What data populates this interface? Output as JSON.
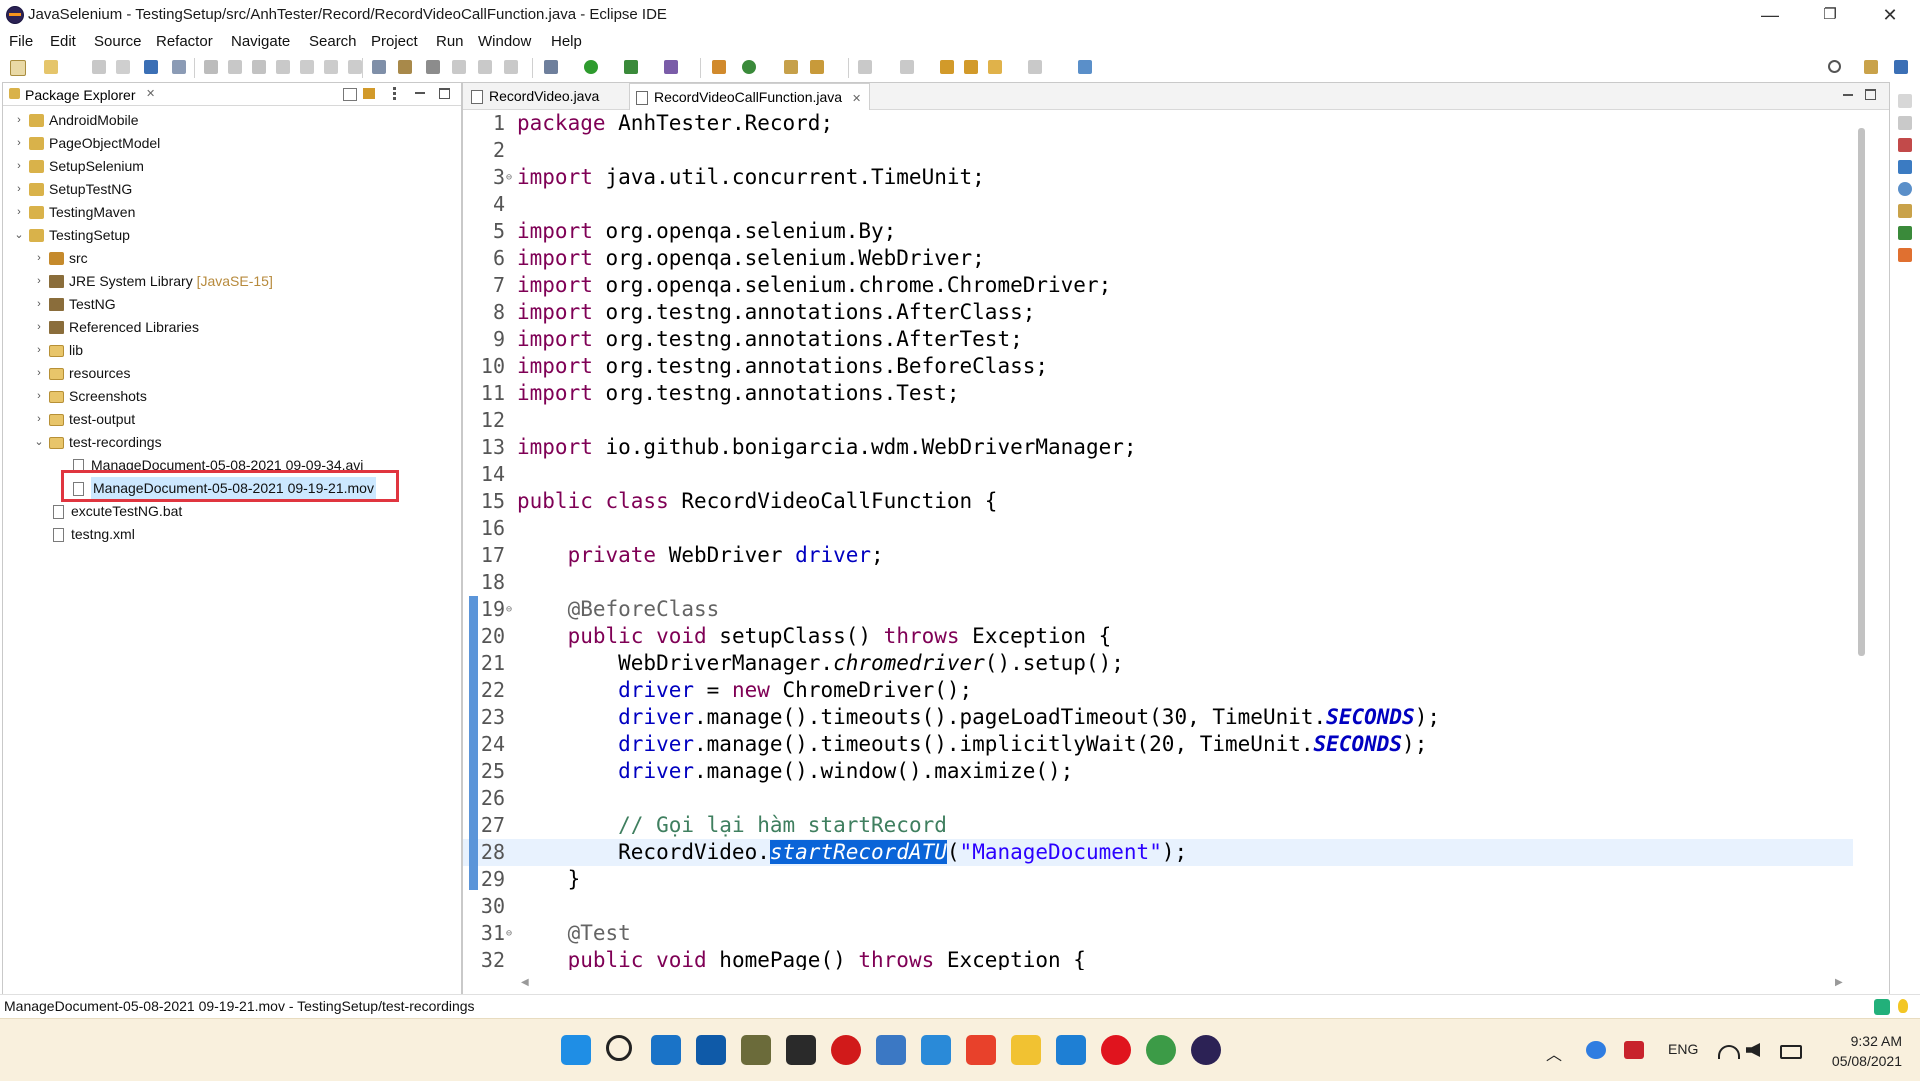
{
  "window": {
    "title": "JavaSelenium - TestingSetup/src/AnhTester/Record/RecordVideoCallFunction.java - Eclipse IDE",
    "minimize": "—",
    "restore": "❐",
    "close": "✕"
  },
  "menu": [
    "File",
    "Edit",
    "Source",
    "Refactor",
    "Navigate",
    "Search",
    "Project",
    "Run",
    "Window",
    "Help"
  ],
  "explorer": {
    "title": "Package Explorer",
    "close_glyph": "✕",
    "items": [
      {
        "label": "AndroidMobile",
        "chev": "›"
      },
      {
        "label": "PageObjectModel",
        "chev": "›"
      },
      {
        "label": "SetupSelenium",
        "chev": "›"
      },
      {
        "label": "SetupTestNG",
        "chev": "›"
      },
      {
        "label": "TestingMaven",
        "chev": "›"
      },
      {
        "label": "TestingSetup",
        "chev": "⌄"
      },
      {
        "label": "src",
        "chev": "›"
      },
      {
        "label": "JRE System Library",
        "decoration": "[JavaSE-15]",
        "chev": "›"
      },
      {
        "label": "TestNG",
        "chev": "›"
      },
      {
        "label": "Referenced Libraries",
        "chev": "›"
      },
      {
        "label": "lib",
        "chev": "›"
      },
      {
        "label": "resources",
        "chev": "›"
      },
      {
        "label": "Screenshots",
        "chev": "›"
      },
      {
        "label": "test-output",
        "chev": "›"
      },
      {
        "label": "test-recordings",
        "chev": "⌄"
      },
      {
        "label": "ManageDocument-05-08-2021 09-09-34.avi",
        "chev": ""
      },
      {
        "label": "ManageDocument-05-08-2021 09-19-21.mov",
        "chev": ""
      },
      {
        "label": "excuteTestNG.bat",
        "chev": ""
      },
      {
        "label": "testng.xml",
        "chev": ""
      }
    ]
  },
  "editor": {
    "tabs": [
      {
        "label": "RecordVideo.java"
      },
      {
        "label": "RecordVideoCallFunction.java",
        "close_glyph": "✕"
      }
    ],
    "lines": [
      {
        "n": "1",
        "html": "<span class=\"kw\">package</span> AnhTester.Record;"
      },
      {
        "n": "2",
        "html": ""
      },
      {
        "n": "3",
        "fold": "⊖",
        "html": "<span class=\"kw\">import</span> java.util.concurrent.TimeUnit;"
      },
      {
        "n": "4",
        "html": ""
      },
      {
        "n": "5",
        "html": "<span class=\"kw\">import</span> org.openqa.selenium.By;"
      },
      {
        "n": "6",
        "html": "<span class=\"kw\">import</span> org.openqa.selenium.WebDriver;"
      },
      {
        "n": "7",
        "html": "<span class=\"kw\">import</span> org.openqa.selenium.chrome.ChromeDriver;"
      },
      {
        "n": "8",
        "html": "<span class=\"kw\">import</span> org.testng.annotations.AfterClass;"
      },
      {
        "n": "9",
        "html": "<span class=\"kw\">import</span> org.testng.annotations.AfterTest;"
      },
      {
        "n": "10",
        "html": "<span class=\"kw\">import</span> org.testng.annotations.BeforeClass;"
      },
      {
        "n": "11",
        "html": "<span class=\"kw\">import</span> org.testng.annotations.Test;"
      },
      {
        "n": "12",
        "html": ""
      },
      {
        "n": "13",
        "html": "<span class=\"kw\">import</span> io.github.bonigarcia.wdm.WebDriverManager;"
      },
      {
        "n": "14",
        "html": ""
      },
      {
        "n": "15",
        "html": "<span class=\"kw\">public class</span> RecordVideoCallFunction {"
      },
      {
        "n": "16",
        "html": ""
      },
      {
        "n": "17",
        "html": "    <span class=\"kw\">private</span> WebDriver <span class=\"fld\">driver</span>;"
      },
      {
        "n": "18",
        "html": ""
      },
      {
        "n": "19",
        "fold": "⊖",
        "html": "    <span class=\"ann\">@BeforeClass</span>"
      },
      {
        "n": "20",
        "html": "    <span class=\"kw\">public void</span> setupClass() <span class=\"kw\">throws</span> Exception {"
      },
      {
        "n": "21",
        "html": "        WebDriverManager.<span class=\"ital\">chromedriver</span>().setup();"
      },
      {
        "n": "22",
        "html": "        <span class=\"fld\">driver</span> = <span class=\"kw\">new</span> ChromeDriver();"
      },
      {
        "n": "23",
        "html": "        <span class=\"fld\">driver</span>.manage().timeouts().pageLoadTimeout(30, TimeUnit.<span class=\"sfld\">SECONDS</span>);"
      },
      {
        "n": "24",
        "html": "        <span class=\"fld\">driver</span>.manage().timeouts().implicitlyWait(20, TimeUnit.<span class=\"sfld\">SECONDS</span>);"
      },
      {
        "n": "25",
        "html": "        <span class=\"fld\">driver</span>.manage().window().maximize();"
      },
      {
        "n": "26",
        "html": ""
      },
      {
        "n": "27",
        "html": "        <span class=\"cmt\">// Gọi lại hàm startRecord</span>"
      },
      {
        "n": "28",
        "current": true,
        "html": "        RecordVideo.<span class=\"sel\">startRecordATU</span>(<span class=\"str\">\"ManageDocument\"</span>);"
      },
      {
        "n": "29",
        "html": "    }"
      },
      {
        "n": "30",
        "html": ""
      },
      {
        "n": "31",
        "fold": "⊖",
        "html": "    <span class=\"ann\">@Test</span>"
      },
      {
        "n": "32",
        "html": "    <span class=\"kw\">public void</span> homePage() <span class=\"kw\">throws</span> Exception {"
      }
    ]
  },
  "status": {
    "text": "ManageDocument-05-08-2021 09-19-21.mov - TestingSetup/test-recordings"
  },
  "taskbar": {
    "language": "ENG",
    "time": "9:32 AM",
    "date": "05/08/2021",
    "tray_chevron": "︿",
    "icons": [
      {
        "name": "start-icon",
        "color": "#1f8ee5"
      },
      {
        "name": "search-icon",
        "color": "#222222"
      },
      {
        "name": "mail-icon",
        "color": "#1a73c7"
      },
      {
        "name": "outlook-icon",
        "color": "#0f5aa8"
      },
      {
        "name": "instant-demo-icon",
        "color": "#6b6b3a"
      },
      {
        "name": "recorder-icon",
        "color": "#2a2a2a"
      },
      {
        "name": "record-dot-icon",
        "color": "#d11a1a"
      },
      {
        "name": "notepad-icon",
        "color": "#3b78c4"
      },
      {
        "name": "blue-s-app-icon",
        "color": "#2a8ad8"
      },
      {
        "name": "red-s-app-icon",
        "color": "#e8412b"
      },
      {
        "name": "file-explorer-icon",
        "color": "#f1c232"
      },
      {
        "name": "vscode-icon",
        "color": "#1e7fd4"
      },
      {
        "name": "opera-icon",
        "color": "#e0141e"
      },
      {
        "name": "chrome-icon",
        "color": "#3c9b47"
      },
      {
        "name": "eclipse-icon",
        "color": "#2c2255"
      }
    ]
  }
}
